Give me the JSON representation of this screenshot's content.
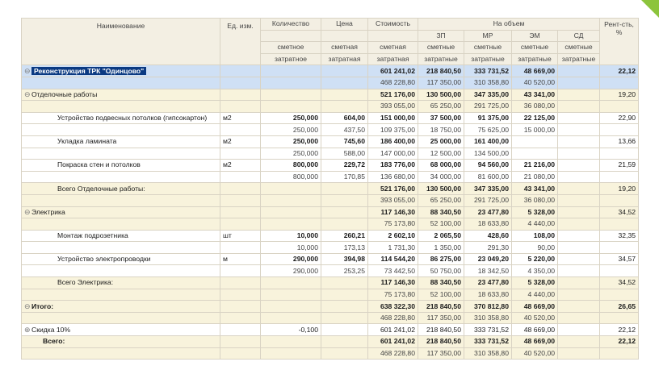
{
  "headers": {
    "name": "Наименование",
    "unit": "Ед. изм.",
    "qty": "Количество",
    "price": "Цена",
    "cost": "Стоимость",
    "volume": "На объем",
    "rent": "Рент-сть, %",
    "zp": "ЗП",
    "mr": "МР",
    "em": "ЭМ",
    "sd": "СД",
    "smetnoe": "сметное",
    "smetnaya": "сметная",
    "smetnye": "сметные",
    "zatratnoe": "затратное",
    "zatratnaya": "затратная",
    "zatratnye": "затратные"
  },
  "rows": [
    {
      "type": "top",
      "name": "Реконструкция ТРК \"Одинцово\"",
      "cost": "601 241,02",
      "zp": "218 840,50",
      "mr": "333 731,52",
      "em": "48 669,00",
      "sd": "",
      "rent": "22,12",
      "cost2": "468 228,80",
      "zp2": "117 350,00",
      "mr2": "310 358,80",
      "em2": "40 520,00"
    },
    {
      "type": "sect",
      "name": "Отделочные работы",
      "cost": "521 176,00",
      "zp": "130 500,00",
      "mr": "347 335,00",
      "em": "43 341,00",
      "rent": "19,20",
      "cost2": "393 055,00",
      "zp2": "65 250,00",
      "mr2": "291 725,00",
      "em2": "36 080,00"
    },
    {
      "type": "item",
      "name": "Устройство подвесных потолков (гипсокартон)",
      "unit": "м2",
      "qty": "250,000",
      "price": "604,00",
      "cost": "151 000,00",
      "zp": "37 500,00",
      "mr": "91 375,00",
      "em": "22 125,00",
      "rent": "22,90",
      "qty2": "250,000",
      "price2": "437,50",
      "cost2": "109 375,00",
      "zp2": "18 750,00",
      "mr2": "75 625,00",
      "em2": "15 000,00"
    },
    {
      "type": "item",
      "name": "Укладка ламината",
      "unit": "м2",
      "qty": "250,000",
      "price": "745,60",
      "cost": "186 400,00",
      "zp": "25 000,00",
      "mr": "161 400,00",
      "em": "",
      "rent": "13,66",
      "qty2": "250,000",
      "price2": "588,00",
      "cost2": "147 000,00",
      "zp2": "12 500,00",
      "mr2": "134 500,00",
      "em2": ""
    },
    {
      "type": "item",
      "name": "Покраска стен и потолков",
      "unit": "м2",
      "qty": "800,000",
      "price": "229,72",
      "cost": "183 776,00",
      "zp": "68 000,00",
      "mr": "94 560,00",
      "em": "21 216,00",
      "rent": "21,59",
      "qty2": "800,000",
      "price2": "170,85",
      "cost2": "136 680,00",
      "zp2": "34 000,00",
      "mr2": "81 600,00",
      "em2": "21 080,00"
    },
    {
      "type": "tot",
      "name": "Всего Отделочные работы:",
      "cost": "521 176,00",
      "zp": "130 500,00",
      "mr": "347 335,00",
      "em": "43 341,00",
      "rent": "19,20",
      "cost2": "393 055,00",
      "zp2": "65 250,00",
      "mr2": "291 725,00",
      "em2": "36 080,00"
    },
    {
      "type": "sect",
      "name": "Электрика",
      "cost": "117 146,30",
      "zp": "88 340,50",
      "mr": "23 477,80",
      "em": "5 328,00",
      "rent": "34,52",
      "cost2": "75 173,80",
      "zp2": "52 100,00",
      "mr2": "18 633,80",
      "em2": "4 440,00"
    },
    {
      "type": "item",
      "name": "Монтаж подрозетника",
      "unit": "шт",
      "qty": "10,000",
      "price": "260,21",
      "cost": "2 602,10",
      "zp": "2 065,50",
      "mr": "428,60",
      "em": "108,00",
      "rent": "32,35",
      "qty2": "10,000",
      "price2": "173,13",
      "cost2": "1 731,30",
      "zp2": "1 350,00",
      "mr2": "291,30",
      "em2": "90,00"
    },
    {
      "type": "item",
      "name": "Устройство электропроводки",
      "unit": "м",
      "qty": "290,000",
      "price": "394,98",
      "cost": "114 544,20",
      "zp": "86 275,00",
      "mr": "23 049,20",
      "em": "5 220,00",
      "rent": "34,57",
      "qty2": "290,000",
      "price2": "253,25",
      "cost2": "73 442,50",
      "zp2": "50 750,00",
      "mr2": "18 342,50",
      "em2": "4 350,00"
    },
    {
      "type": "tot",
      "name": "Всего Электрика:",
      "cost": "117 146,30",
      "zp": "88 340,50",
      "mr": "23 477,80",
      "em": "5 328,00",
      "rent": "34,52",
      "cost2": "75 173,80",
      "zp2": "52 100,00",
      "mr2": "18 633,80",
      "em2": "4 440,00"
    },
    {
      "type": "itog",
      "name": "Итого:",
      "cost": "638 322,30",
      "zp": "218 840,50",
      "mr": "370 812,80",
      "em": "48 669,00",
      "rent": "26,65",
      "cost2": "468 228,80",
      "zp2": "117 350,00",
      "mr2": "310 358,80",
      "em2": "40 520,00"
    },
    {
      "type": "disc",
      "name": "Скидка 10%",
      "price": "-0,100",
      "cost": "601 241,02",
      "zp": "218 840,50",
      "mr": "333 731,52",
      "em": "48 669,00",
      "rent": "22,12"
    },
    {
      "type": "grand",
      "name": "Всего:",
      "cost": "601 241,02",
      "zp": "218 840,50",
      "mr": "333 731,52",
      "em": "48 669,00",
      "rent": "22,12",
      "cost2": "468 228,80",
      "zp2": "117 350,00",
      "mr2": "310 358,80",
      "em2": "40 520,00"
    }
  ],
  "colors": {
    "accent": "#8cc43c",
    "selection": "#0b3a82",
    "top_row": "#cfe0f5",
    "section": "#f8f3dc"
  }
}
